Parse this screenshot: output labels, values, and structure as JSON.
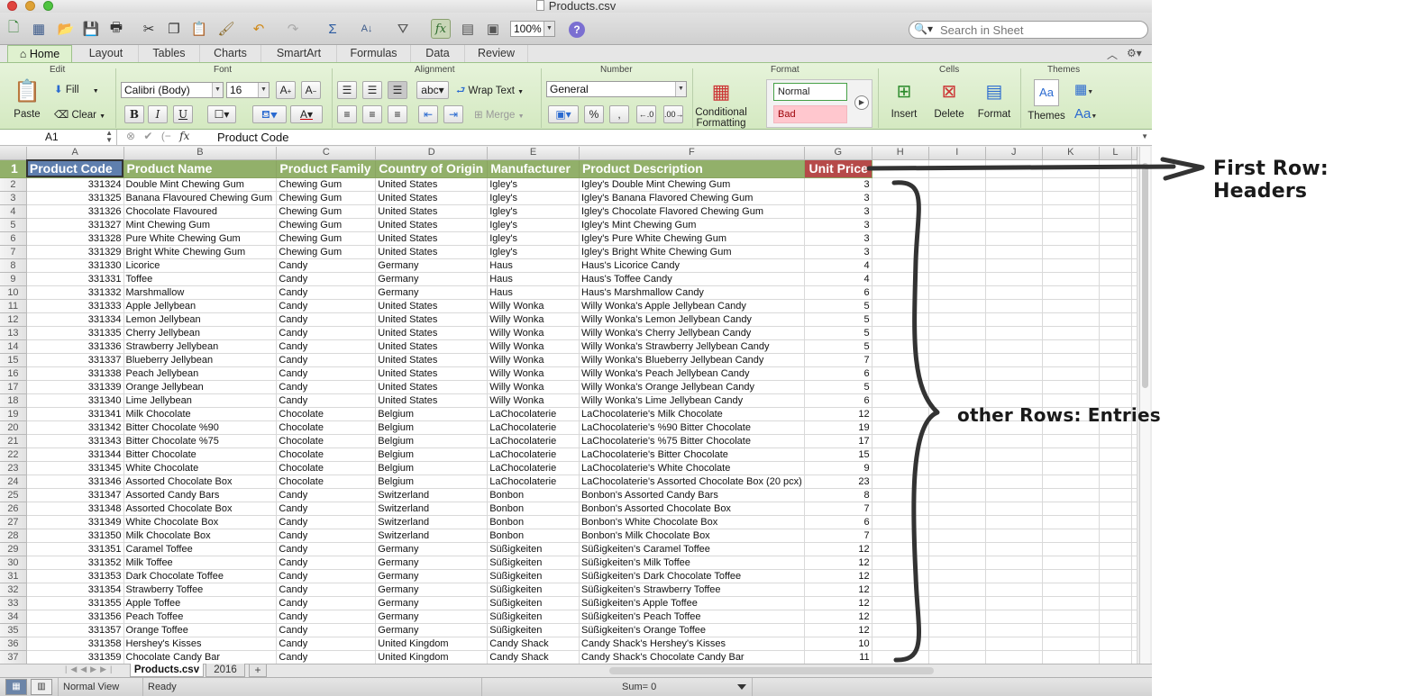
{
  "window": {
    "title": "Products.csv"
  },
  "toolbar": {
    "zoom": "100%",
    "search_placeholder": "Search in Sheet",
    "icons": [
      "new-icon",
      "templates-icon",
      "open-icon",
      "save-icon",
      "print-icon",
      "cut-icon",
      "copy-icon",
      "paste-icon",
      "format-painter-icon",
      "undo-icon",
      "redo-icon",
      "autosum-icon",
      "sort-icon",
      "filter-icon",
      "formula-builder-icon",
      "gallery-icon",
      "toolbox-icon",
      "help-icon"
    ]
  },
  "ribbon": {
    "tabs": [
      "Home",
      "Layout",
      "Tables",
      "Charts",
      "SmartArt",
      "Formulas",
      "Data",
      "Review"
    ],
    "groups": {
      "edit": "Edit",
      "font": "Font",
      "alignment": "Alignment",
      "number": "Number",
      "format": "Format",
      "cells": "Cells",
      "themes": "Themes"
    },
    "paste": "Paste",
    "fill": "Fill",
    "clear": "Clear",
    "font_name": "Calibri (Body)",
    "font_size": "16",
    "bold": "B",
    "italic": "I",
    "underline": "U",
    "wrap_text": "Wrap Text",
    "merge": "Merge",
    "abc": "abc",
    "number_format": "General",
    "percent": "%",
    "comma": ",",
    "conditional_formatting_1": "Conditional",
    "conditional_formatting_2": "Formatting",
    "style_normal": "Normal",
    "style_bad": "Bad",
    "insert": "Insert",
    "delete": "Delete",
    "format_btn": "Format",
    "themes_btn": "Themes",
    "aa": "Aa"
  },
  "formula_bar": {
    "cell_ref": "A1",
    "content": "Product Code",
    "fx": "fx"
  },
  "grid": {
    "columns": [
      "A",
      "B",
      "C",
      "D",
      "E",
      "F",
      "G",
      "H",
      "I",
      "J",
      "K",
      "L"
    ],
    "headers": [
      "Product Code",
      "Product Name",
      "Product Family",
      "Country of Origin",
      "Manufacturer",
      "Product Description",
      "Unit Price"
    ],
    "rows": [
      [
        "331324",
        "Double Mint Chewing Gum",
        "Chewing Gum",
        "United States",
        "Igley's",
        "Igley's Double Mint Chewing Gum",
        "3"
      ],
      [
        "331325",
        "Banana Flavoured Chewing Gum",
        "Chewing Gum",
        "United States",
        "Igley's",
        "Igley's Banana Flavored Chewing Gum",
        "3"
      ],
      [
        "331326",
        "Chocolate Flavoured",
        "Chewing Gum",
        "United States",
        "Igley's",
        "Igley's Chocolate Flavored Chewing Gum",
        "3"
      ],
      [
        "331327",
        "Mint Chewing Gum",
        "Chewing Gum",
        "United States",
        "Igley's",
        "Igley's Mint Chewing Gum",
        "3"
      ],
      [
        "331328",
        "Pure White Chewing Gum",
        "Chewing Gum",
        "United States",
        "Igley's",
        "Igley's Pure White Chewing Gum",
        "3"
      ],
      [
        "331329",
        "Bright White Chewing Gum",
        "Chewing Gum",
        "United States",
        "Igley's",
        "Igley's Bright White Chewing Gum",
        "3"
      ],
      [
        "331330",
        "Licorice",
        "Candy",
        "Germany",
        "Haus",
        "Haus's Licorice Candy",
        "4"
      ],
      [
        "331331",
        "Toffee",
        "Candy",
        "Germany",
        "Haus",
        "Haus's Toffee Candy",
        "4"
      ],
      [
        "331332",
        "Marshmallow",
        "Candy",
        "Germany",
        "Haus",
        "Haus's Marshmallow Candy",
        "6"
      ],
      [
        "331333",
        "Apple Jellybean",
        "Candy",
        "United States",
        "Willy Wonka",
        "Willy Wonka's Apple Jellybean Candy",
        "5"
      ],
      [
        "331334",
        "Lemon Jellybean",
        "Candy",
        "United States",
        "Willy Wonka",
        "Willy Wonka's Lemon Jellybean Candy",
        "5"
      ],
      [
        "331335",
        "Cherry Jellybean",
        "Candy",
        "United States",
        "Willy Wonka",
        "Willy Wonka's Cherry Jellybean Candy",
        "5"
      ],
      [
        "331336",
        "Strawberry Jellybean",
        "Candy",
        "United States",
        "Willy Wonka",
        "Willy Wonka's Strawberry Jellybean Candy",
        "5"
      ],
      [
        "331337",
        "Blueberry Jellybean",
        "Candy",
        "United States",
        "Willy Wonka",
        "Willy Wonka's Blueberry Jellybean Candy",
        "7"
      ],
      [
        "331338",
        "Peach Jellybean",
        "Candy",
        "United States",
        "Willy Wonka",
        "Willy Wonka's Peach Jellybean Candy",
        "6"
      ],
      [
        "331339",
        "Orange Jellybean",
        "Candy",
        "United States",
        "Willy Wonka",
        "Willy Wonka's Orange Jellybean Candy",
        "5"
      ],
      [
        "331340",
        "Lime Jellybean",
        "Candy",
        "United States",
        "Willy Wonka",
        "Willy Wonka's Lime Jellybean Candy",
        "6"
      ],
      [
        "331341",
        "Milk Chocolate",
        "Chocolate",
        "Belgium",
        "LaChocolaterie",
        "LaChocolaterie's Milk Chocolate",
        "12"
      ],
      [
        "331342",
        "Bitter Chocolate %90",
        "Chocolate",
        "Belgium",
        "LaChocolaterie",
        "LaChocolaterie's %90 Bitter Chocolate",
        "19"
      ],
      [
        "331343",
        "Bitter Chocolate %75",
        "Chocolate",
        "Belgium",
        "LaChocolaterie",
        "LaChocolaterie's %75 Bitter Chocolate",
        "17"
      ],
      [
        "331344",
        "Bitter Chocolate",
        "Chocolate",
        "Belgium",
        "LaChocolaterie",
        "LaChocolaterie's Bitter Chocolate",
        "15"
      ],
      [
        "331345",
        "White Chocolate",
        "Chocolate",
        "Belgium",
        "LaChocolaterie",
        "LaChocolaterie's White Chocolate",
        "9"
      ],
      [
        "331346",
        "Assorted Chocolate Box",
        "Chocolate",
        "Belgium",
        "LaChocolaterie",
        "LaChocolaterie's Assorted Chocolate Box (20 pcx)",
        "23"
      ],
      [
        "331347",
        "Assorted Candy Bars",
        "Candy",
        "Switzerland",
        "Bonbon",
        "Bonbon's Assorted Candy Bars",
        "8"
      ],
      [
        "331348",
        "Assorted Chocolate Box",
        "Candy",
        "Switzerland",
        "Bonbon",
        "Bonbon's Assorted Chocolate Box",
        "7"
      ],
      [
        "331349",
        "White Chocolate Box",
        "Candy",
        "Switzerland",
        "Bonbon",
        "Bonbon's White Chocolate Box",
        "6"
      ],
      [
        "331350",
        "Milk Chocolate Box",
        "Candy",
        "Switzerland",
        "Bonbon",
        "Bonbon's Milk Chocolate Box",
        "7"
      ],
      [
        "331351",
        "Caramel Toffee",
        "Candy",
        "Germany",
        "Süßigkeiten",
        "Süßigkeiten's Caramel Toffee",
        "12"
      ],
      [
        "331352",
        "Milk Toffee",
        "Candy",
        "Germany",
        "Süßigkeiten",
        "Süßigkeiten's Milk Toffee",
        "12"
      ],
      [
        "331353",
        "Dark Chocolate Toffee",
        "Candy",
        "Germany",
        "Süßigkeiten",
        "Süßigkeiten's Dark Chocolate Toffee",
        "12"
      ],
      [
        "331354",
        "Strawberry Toffee",
        "Candy",
        "Germany",
        "Süßigkeiten",
        "Süßigkeiten's Strawberry Toffee",
        "12"
      ],
      [
        "331355",
        "Apple Toffee",
        "Candy",
        "Germany",
        "Süßigkeiten",
        "Süßigkeiten's Apple Toffee",
        "12"
      ],
      [
        "331356",
        "Peach Toffee",
        "Candy",
        "Germany",
        "Süßigkeiten",
        "Süßigkeiten's Peach Toffee",
        "12"
      ],
      [
        "331357",
        "Orange Toffee",
        "Candy",
        "Germany",
        "Süßigkeiten",
        "Süßigkeiten's Orange Toffee",
        "12"
      ],
      [
        "331358",
        "Hershey's Kisses",
        "Candy",
        "United Kingdom",
        "Candy Shack",
        "Candy Shack's Hershey's Kisses",
        "10"
      ],
      [
        "331359",
        "Chocolate Candy Bar",
        "Candy",
        "United Kingdom",
        "Candy Shack",
        "Candy Shack's Chocolate Candy Bar",
        "11"
      ]
    ]
  },
  "sheets": [
    "Products.csv",
    "2016"
  ],
  "status": {
    "view": "Normal View",
    "ready": "Ready",
    "sum": "Sum= 0"
  },
  "annotations": {
    "headers": "First Row: Headers",
    "entries": "other Rows: Entries"
  },
  "colors": {
    "header_green": "#92b06a",
    "selected_header": "#5f7fae",
    "price_header": "#b64a49",
    "ribbon_green": "#dff1cf"
  }
}
